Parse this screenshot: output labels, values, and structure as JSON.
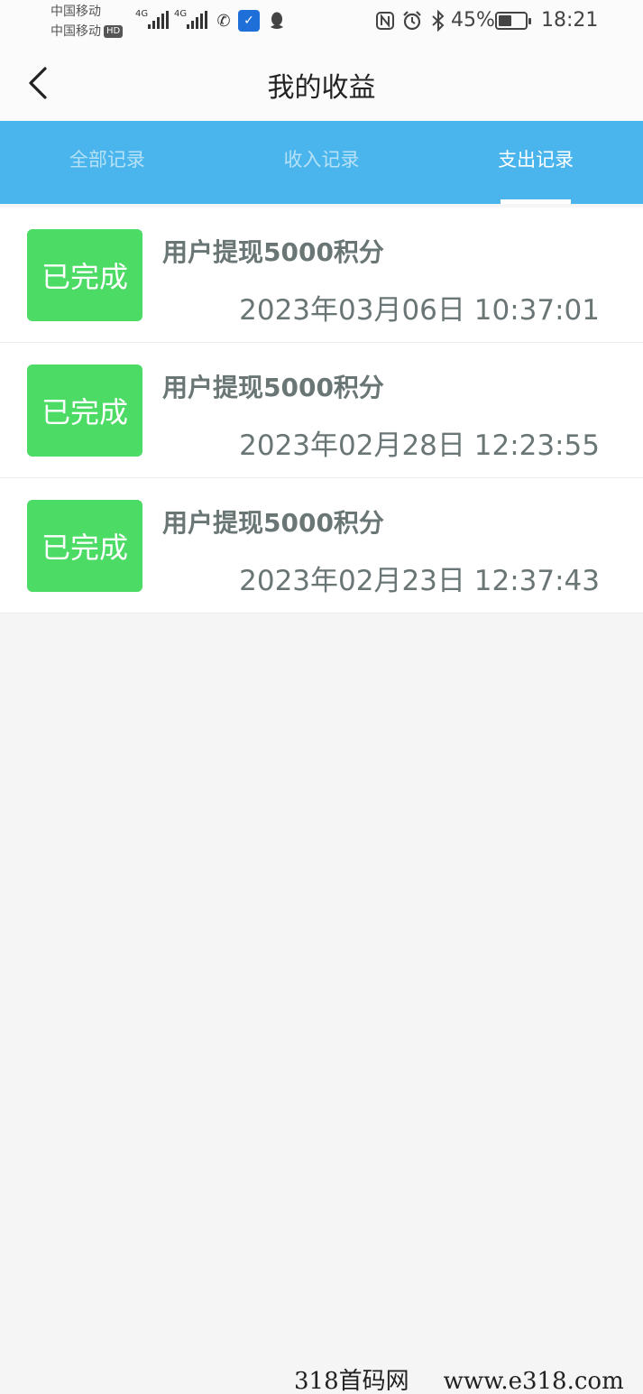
{
  "status_bar": {
    "carrier_1": "中国移动",
    "carrier_2": "中国移动",
    "hd_badge": "HD",
    "network_1": "4G",
    "network_2": "4G",
    "battery_percent": "45%",
    "battery_level": 0.45,
    "time": "18:21",
    "icons": [
      "signal-icon",
      "signal-icon",
      "wifi-calling-icon",
      "security-shield-icon",
      "qq-icon",
      "nfc-icon",
      "alarm-icon",
      "bluetooth-icon",
      "battery-icon"
    ]
  },
  "nav": {
    "title": "我的收益",
    "back_icon": "chevron-left-icon"
  },
  "tabs": [
    {
      "label": "全部记录",
      "active": false
    },
    {
      "label": "收入记录",
      "active": false
    },
    {
      "label": "支出记录",
      "active": true
    }
  ],
  "records": [
    {
      "status": "已完成",
      "title": "用户提现5000积分",
      "time": "2023年03月06日 10:37:01"
    },
    {
      "status": "已完成",
      "title": "用户提现5000积分",
      "time": "2023年02月28日 12:23:55"
    },
    {
      "status": "已完成",
      "title": "用户提现5000积分",
      "time": "2023年02月23日 12:37:43"
    }
  ],
  "watermark": {
    "site_name": "318首码网",
    "url": "www.e318.com"
  },
  "colors": {
    "tab_bar": "#49b5ec",
    "status_badge": "#4cdb64",
    "record_text": "#6a7675",
    "background": "#f5f5f5"
  }
}
